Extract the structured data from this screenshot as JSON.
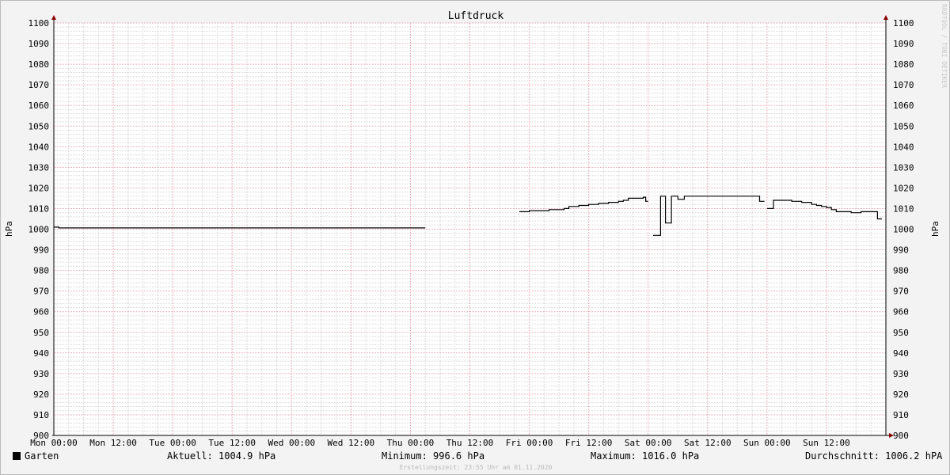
{
  "chart_data": {
    "type": "line",
    "title": "Luftdruck",
    "ylabel": "hPa",
    "ylim": [
      900,
      1100
    ],
    "y_ticks": [
      900,
      910,
      920,
      930,
      940,
      950,
      960,
      970,
      980,
      990,
      1000,
      1010,
      1020,
      1030,
      1040,
      1050,
      1060,
      1070,
      1080,
      1090,
      1100
    ],
    "x_range_hours": [
      0,
      168
    ],
    "x_ticks": [
      {
        "label": "Mon 00:00",
        "hour": 0
      },
      {
        "label": "Mon 12:00",
        "hour": 12
      },
      {
        "label": "Tue 00:00",
        "hour": 24
      },
      {
        "label": "Tue 12:00",
        "hour": 36
      },
      {
        "label": "Wed 00:00",
        "hour": 48
      },
      {
        "label": "Wed 12:00",
        "hour": 60
      },
      {
        "label": "Thu 00:00",
        "hour": 72
      },
      {
        "label": "Thu 12:00",
        "hour": 84
      },
      {
        "label": "Fri 00:00",
        "hour": 96
      },
      {
        "label": "Fri 12:00",
        "hour": 108
      },
      {
        "label": "Sat 00:00",
        "hour": 120
      },
      {
        "label": "Sat 12:00",
        "hour": 132
      },
      {
        "label": "Sun 00:00",
        "hour": 144
      },
      {
        "label": "Sun 12:00",
        "hour": 156
      }
    ],
    "grid": true,
    "series": [
      {
        "name": "Garten",
        "color": "#000000",
        "segments": [
          [
            [
              0,
              1001
            ],
            [
              1,
              1000.6
            ],
            [
              75,
              1000.6
            ]
          ],
          [
            [
              94,
              1008.5
            ],
            [
              96,
              1009
            ],
            [
              98,
              1009
            ],
            [
              100,
              1009.5
            ],
            [
              103,
              1010
            ],
            [
              104,
              1011
            ],
            [
              106,
              1011.5
            ],
            [
              108,
              1012
            ],
            [
              110,
              1012.5
            ],
            [
              112,
              1013
            ],
            [
              114,
              1013.5
            ],
            [
              115,
              1014
            ],
            [
              116,
              1015
            ],
            [
              118,
              1015
            ],
            [
              119,
              1015.5
            ],
            [
              119.5,
              1013.5
            ],
            [
              120,
              1013.5
            ]
          ],
          [
            [
              121,
              997
            ],
            [
              122,
              997
            ],
            [
              122.5,
              1016
            ],
            [
              123.2,
              1016
            ],
            [
              123.5,
              1003
            ],
            [
              124.3,
              1003
            ],
            [
              124.7,
              1016
            ],
            [
              125.5,
              1016
            ],
            [
              126,
              1014.5
            ],
            [
              126.8,
              1014.5
            ],
            [
              127.3,
              1016
            ],
            [
              142,
              1016
            ],
            [
              142.5,
              1013.5
            ],
            [
              143.5,
              1013.5
            ]
          ],
          [
            [
              144,
              1010
            ],
            [
              145,
              1010
            ],
            [
              145.3,
              1014
            ],
            [
              147.5,
              1014
            ],
            [
              149,
              1013.5
            ],
            [
              151,
              1013
            ],
            [
              153,
              1012
            ],
            [
              154,
              1011.5
            ],
            [
              155,
              1011
            ],
            [
              156,
              1010.5
            ],
            [
              157,
              1009.5
            ],
            [
              158,
              1008.5
            ],
            [
              160,
              1008.5
            ],
            [
              161,
              1008
            ],
            [
              162,
              1008
            ],
            [
              163,
              1008.5
            ],
            [
              166,
              1008.5
            ],
            [
              166.3,
              1005
            ],
            [
              167.2,
              1005
            ]
          ]
        ]
      }
    ]
  },
  "legend": {
    "series_name": "Garten",
    "current": "Aktuell: 1004.9 hPa",
    "minimum": "Minimum: 996.6 hPa",
    "maximum": "Maximum: 1016.0 hPa",
    "average": "Durchschnitt: 1006.2 hPA"
  },
  "footer": "Erstellungszeit: 23:55 Uhr am 01.11.2020",
  "watermark": "RRDTOOL / TOBI OETIKER"
}
